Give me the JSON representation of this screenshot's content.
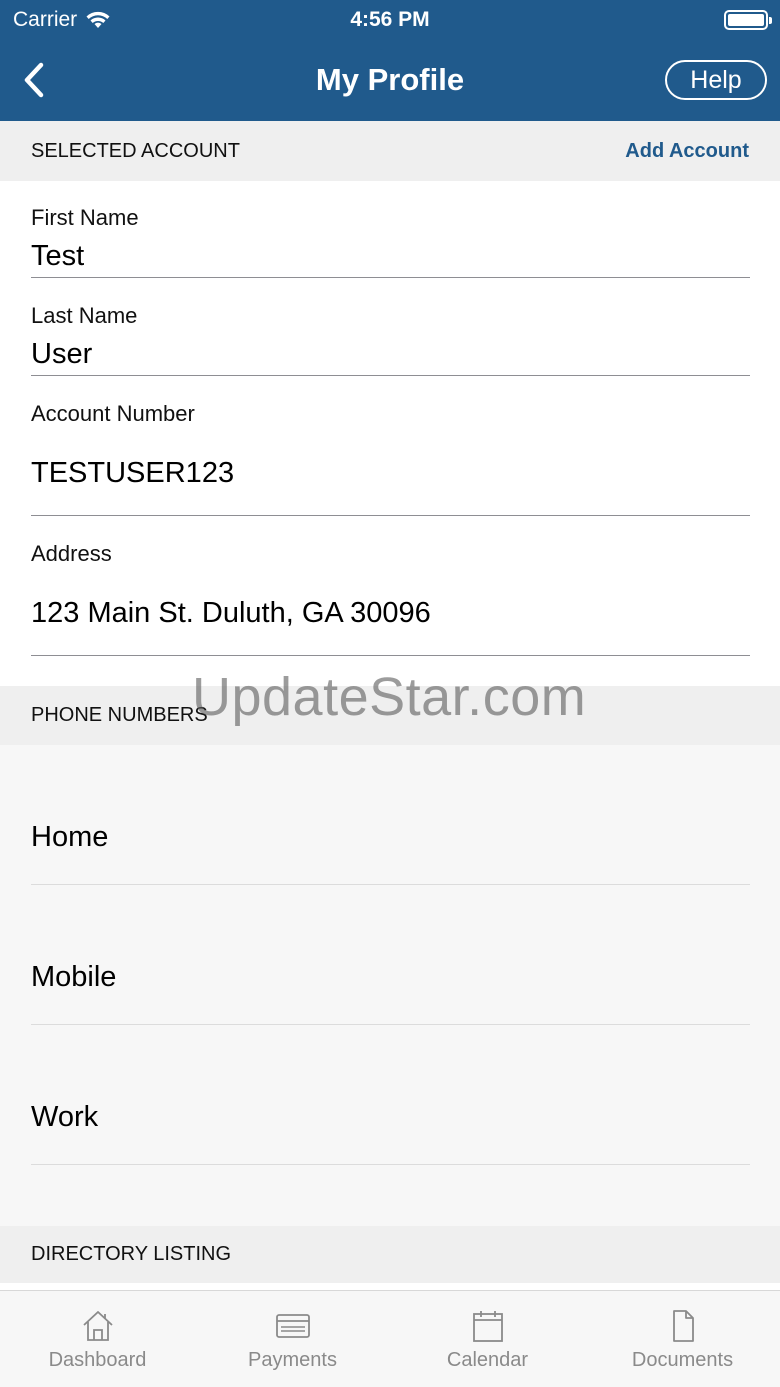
{
  "status_bar": {
    "carrier": "Carrier",
    "time": "4:56 PM"
  },
  "nav": {
    "title": "My Profile",
    "help_label": "Help"
  },
  "selected_account": {
    "header": "SELECTED ACCOUNT",
    "add_account_label": "Add Account",
    "fields": {
      "first_name": {
        "label": "First Name",
        "value": "Test"
      },
      "last_name": {
        "label": "Last Name",
        "value": "User"
      },
      "account_number": {
        "label": "Account Number",
        "value": "TESTUSER123"
      },
      "address": {
        "label": "Address",
        "value": "123 Main St.  Duluth, GA 30096"
      }
    }
  },
  "phone_numbers": {
    "header": "PHONE NUMBERS",
    "items": [
      {
        "label": "Home"
      },
      {
        "label": "Mobile"
      },
      {
        "label": "Work"
      }
    ]
  },
  "directory_listing": {
    "header": "DIRECTORY LISTING"
  },
  "watermark": "UpdateStar.com",
  "tab_bar": {
    "tabs": [
      {
        "label": "Dashboard",
        "icon": "house-icon"
      },
      {
        "label": "Payments",
        "icon": "card-icon"
      },
      {
        "label": "Calendar",
        "icon": "calendar-icon"
      },
      {
        "label": "Documents",
        "icon": "document-icon"
      }
    ]
  },
  "colors": {
    "brand": "#205a8c",
    "section_bg": "#efefef",
    "tab_inactive": "#8a8a8a"
  }
}
